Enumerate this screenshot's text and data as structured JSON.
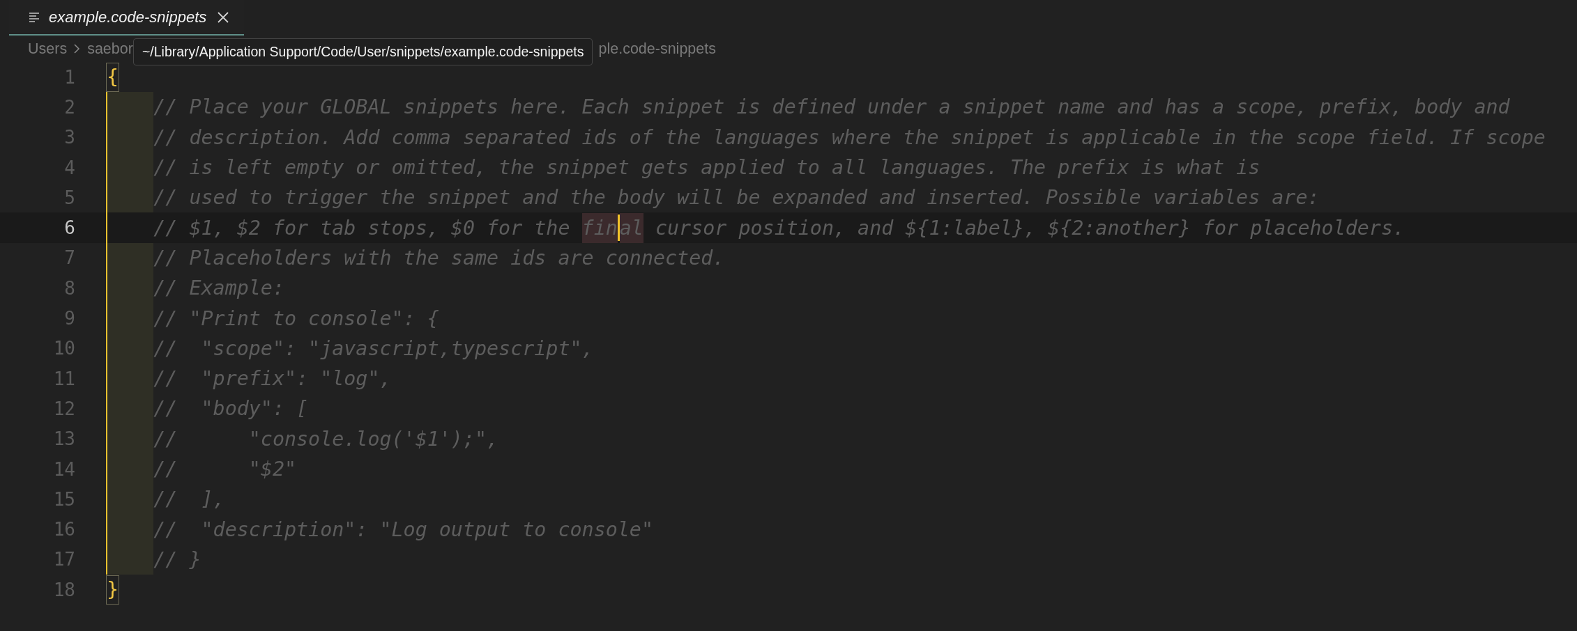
{
  "tab": {
    "title": "example.code-snippets",
    "selected": true,
    "preview": true
  },
  "breadcrumbs": [
    "Users",
    "saebor"
  ],
  "breadcrumb_tail": "ple.code-snippets",
  "tooltip": "~/Library/Application Support/Code/User/snippets/example.code-snippets",
  "lines": [
    {
      "number": "1",
      "kind": "bracket",
      "current": false,
      "text": "{"
    },
    {
      "number": "2",
      "kind": "comment",
      "current": false,
      "text": "// Place your GLOBAL snippets here. Each snippet is defined under a snippet name and has a scope, prefix, body and"
    },
    {
      "number": "3",
      "kind": "comment",
      "current": false,
      "text": "// description. Add comma separated ids of the languages where the snippet is applicable in the scope field. If scope"
    },
    {
      "number": "4",
      "kind": "comment",
      "current": false,
      "text": "// is left empty or omitted, the snippet gets applied to all languages. The prefix is what is"
    },
    {
      "number": "5",
      "kind": "comment",
      "current": false,
      "text": "// used to trigger the snippet and the body will be expanded and inserted. Possible variables are:"
    },
    {
      "number": "6",
      "kind": "comment",
      "current": true,
      "segments": [
        {
          "kind": "plain",
          "text": "// $1, $2 for tab stops, $0 for the "
        },
        {
          "kind": "highlight",
          "text": "fin"
        },
        {
          "kind": "cursor"
        },
        {
          "kind": "highlight",
          "text": "al"
        },
        {
          "kind": "plain",
          "text": " cursor position, and ${1:label}, ${2:another} for placeholders."
        }
      ]
    },
    {
      "number": "7",
      "kind": "comment",
      "current": false,
      "text": "// Placeholders with the same ids are connected."
    },
    {
      "number": "8",
      "kind": "comment",
      "current": false,
      "text": "// Example:"
    },
    {
      "number": "9",
      "kind": "comment",
      "current": false,
      "text": "// \"Print to console\": {"
    },
    {
      "number": "10",
      "kind": "comment",
      "current": false,
      "text": "//  \"scope\": \"javascript,typescript\","
    },
    {
      "number": "11",
      "kind": "comment",
      "current": false,
      "text": "//  \"prefix\": \"log\","
    },
    {
      "number": "12",
      "kind": "comment",
      "current": false,
      "text": "//  \"body\": ["
    },
    {
      "number": "13",
      "kind": "comment",
      "current": false,
      "text": "//      \"console.log('$1');\","
    },
    {
      "number": "14",
      "kind": "comment",
      "current": false,
      "text": "//      \"$2\""
    },
    {
      "number": "15",
      "kind": "comment",
      "current": false,
      "text": "//  ],"
    },
    {
      "number": "16",
      "kind": "comment",
      "current": false,
      "text": "//  \"description\": \"Log output to console\""
    },
    {
      "number": "17",
      "kind": "comment",
      "current": false,
      "text": "// }"
    },
    {
      "number": "18",
      "kind": "bracket",
      "current": false,
      "text": "}"
    }
  ]
}
